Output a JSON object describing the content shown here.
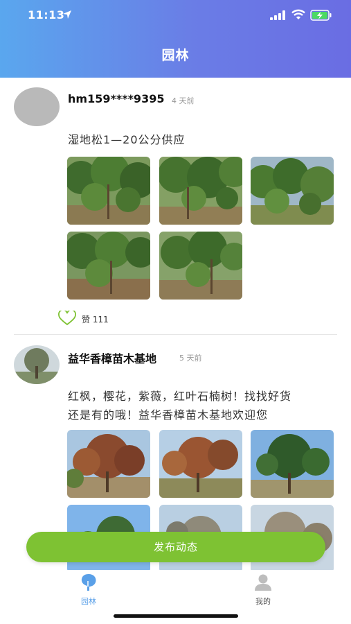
{
  "status_bar": {
    "time": "11:13"
  },
  "header": {
    "title": "园林"
  },
  "posts": [
    {
      "username": "hm159****9395",
      "time_ago": "4 天前",
      "text": "湿地松1—20公分供应",
      "photos": [
        "pine-tree-photo",
        "pine-tree-photo",
        "pine-tree-photo",
        "pine-tree-photo",
        "pine-tree-photo"
      ],
      "like_label": "赞 111"
    },
    {
      "username": "益华香樟苗木基地",
      "time_ago": "5 天前",
      "text_line1": "红枫，樱花，紫薇，红叶石楠树！找找好货",
      "text_line2": "还是有的哦！益华香樟苗木基地欢迎您",
      "photos": [
        "red-maple-photo",
        "red-maple-photo",
        "camphor-tree-photo",
        "tree-photo",
        "tree-photo",
        "tree-photo"
      ]
    }
  ],
  "publish_button": {
    "label": "发布动态"
  },
  "tabbar": {
    "tabs": [
      {
        "label": "园林",
        "icon": "tree-icon",
        "active": true
      },
      {
        "label": "我的",
        "icon": "user-icon",
        "active": false
      }
    ]
  },
  "colors": {
    "header_start": "#5aa7ee",
    "header_end": "#6a6de3",
    "accent_green": "#7ec233",
    "active_tab": "#5aa0e8"
  }
}
